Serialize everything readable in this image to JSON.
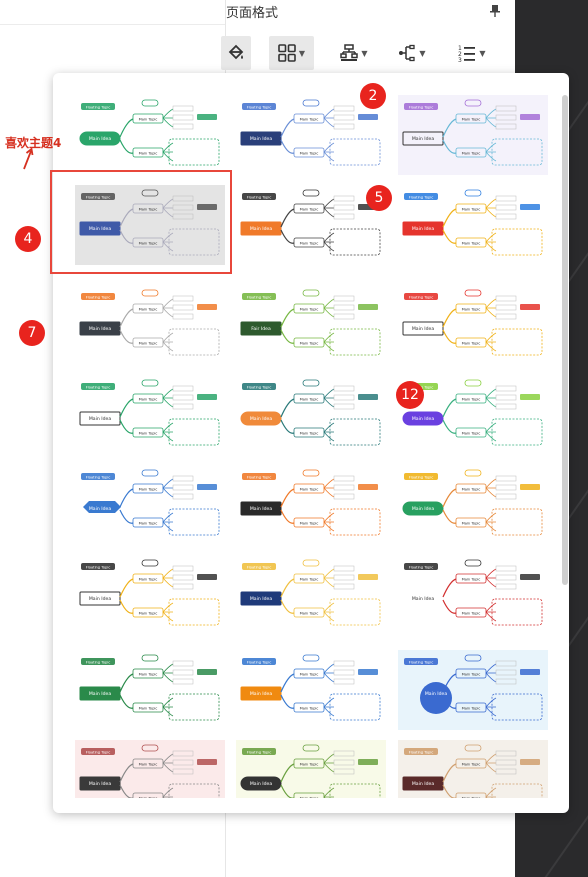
{
  "panel": {
    "title": "页面格式"
  },
  "toolbar": {
    "buttons": [
      {
        "name": "theme-paint-button"
      },
      {
        "name": "layout-grid-button"
      },
      {
        "name": "structure-button"
      },
      {
        "name": "connector-button"
      },
      {
        "name": "numbering-button"
      }
    ]
  },
  "annotation": {
    "label": "喜欢主题4"
  },
  "badges": [
    "2",
    "4",
    "5",
    "7",
    "12"
  ],
  "thumbnail_text": {
    "floating": "Floating Topic",
    "main_topic": "Main Topic",
    "main_idea": "Main Idea",
    "fair_idea": "Fair Idea",
    "main_idea_lower": "Main idea"
  },
  "colors": {
    "accent_red": "#e8241e",
    "annotation_red": "#d63020",
    "selected_border": "#e8473b"
  }
}
